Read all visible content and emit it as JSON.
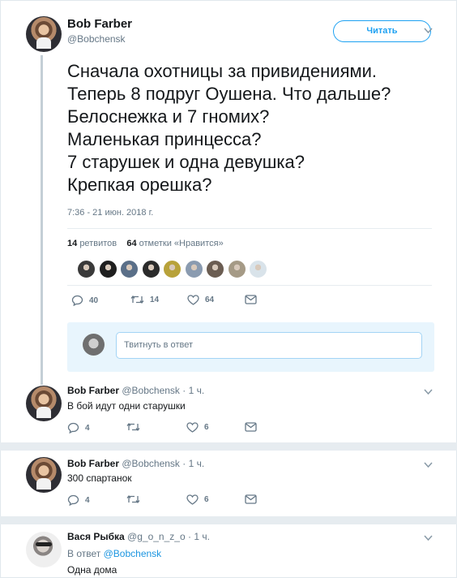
{
  "main_tweet": {
    "name": "Bob Farber",
    "handle": "@Bobchensk",
    "follow_label": "Читать",
    "text_lines": [
      "Сначала охотницы за привидениями.",
      "Теперь 8 подруг Оушена. Что дальше?",
      "Белоснежка и 7 гномих?",
      "Маленькая принцесса?",
      "7 старушек и одна девушка?",
      "Крепкая орешка?"
    ],
    "timestamp": "7:36 - 21 июн. 2018 г.",
    "retweets_count": "14",
    "retweets_label": "ретвитов",
    "likes_count": "64",
    "likes_label": "отметки «Нравится»",
    "actions": {
      "replies": "40",
      "retweets": "14",
      "likes": "64"
    },
    "reply_placeholder": "Твитнуть в ответ"
  },
  "liker_faces": [
    {
      "color": "#3a3a3a"
    },
    {
      "color": "#1f1f1f"
    },
    {
      "color": "#5a6f88"
    },
    {
      "color": "#2b2b2b"
    },
    {
      "color": "#b8a23a"
    },
    {
      "color": "#8a9bb0"
    },
    {
      "color": "#6b5d52"
    },
    {
      "color": "#a59a86"
    },
    {
      "color": "#d9e3ea"
    }
  ],
  "replies": [
    {
      "name": "Bob Farber",
      "handle": "@Bobchensk",
      "time": "1 ч.",
      "text": "В бой идут одни старушки",
      "actions": {
        "replies": "4",
        "retweets": "",
        "likes": "6"
      }
    },
    {
      "name": "Bob Farber",
      "handle": "@Bobchensk",
      "time": "1 ч.",
      "text": "300 спартанок",
      "actions": {
        "replies": "4",
        "retweets": "",
        "likes": "6"
      }
    },
    {
      "name": "Вася Рыбка",
      "handle": "@g_o_n_z_o",
      "time": "1 ч.",
      "reply_to_prefix": "В ответ",
      "reply_to_handle": "@Bobchensk",
      "text": "Одна дома"
    }
  ],
  "colors": {
    "accent": "#1da1f2",
    "like_heart": "#657786",
    "thread_line": "#c4cfd6"
  }
}
